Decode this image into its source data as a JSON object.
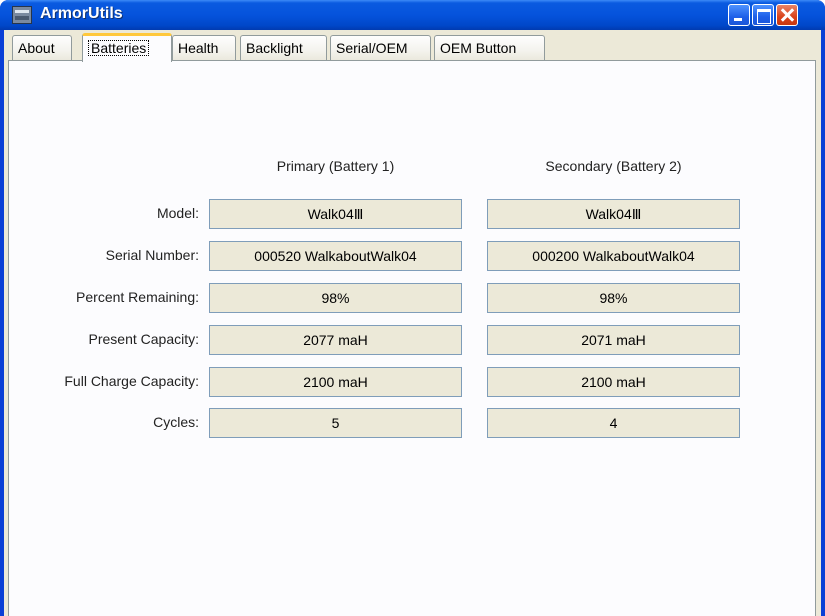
{
  "window": {
    "title": "ArmorUtils"
  },
  "tabs": [
    {
      "label": "About"
    },
    {
      "label": "Batteries"
    },
    {
      "label": "Health"
    },
    {
      "label": "Backlight"
    },
    {
      "label": "Serial/OEM"
    },
    {
      "label": "OEM Button"
    }
  ],
  "active_tab": "Batteries",
  "batteries": {
    "columns": [
      "Primary (Battery 1)",
      "Secondary (Battery 2)"
    ],
    "rows": [
      {
        "label": "Model:",
        "primary": "Walk04Ⅲ",
        "secondary": "Walk04Ⅲ"
      },
      {
        "label": "Serial Number:",
        "primary": "000520 WalkaboutWalk04",
        "secondary": "000200 WalkaboutWalk04"
      },
      {
        "label": "Percent Remaining:",
        "primary": "98%",
        "secondary": "98%"
      },
      {
        "label": "Present Capacity:",
        "primary": "2077 maH",
        "secondary": "2071 maH"
      },
      {
        "label": "Full Charge Capacity:",
        "primary": "2100 maH",
        "secondary": "2100 maH"
      },
      {
        "label": "Cycles:",
        "primary": "5",
        "secondary": "4"
      }
    ]
  }
}
